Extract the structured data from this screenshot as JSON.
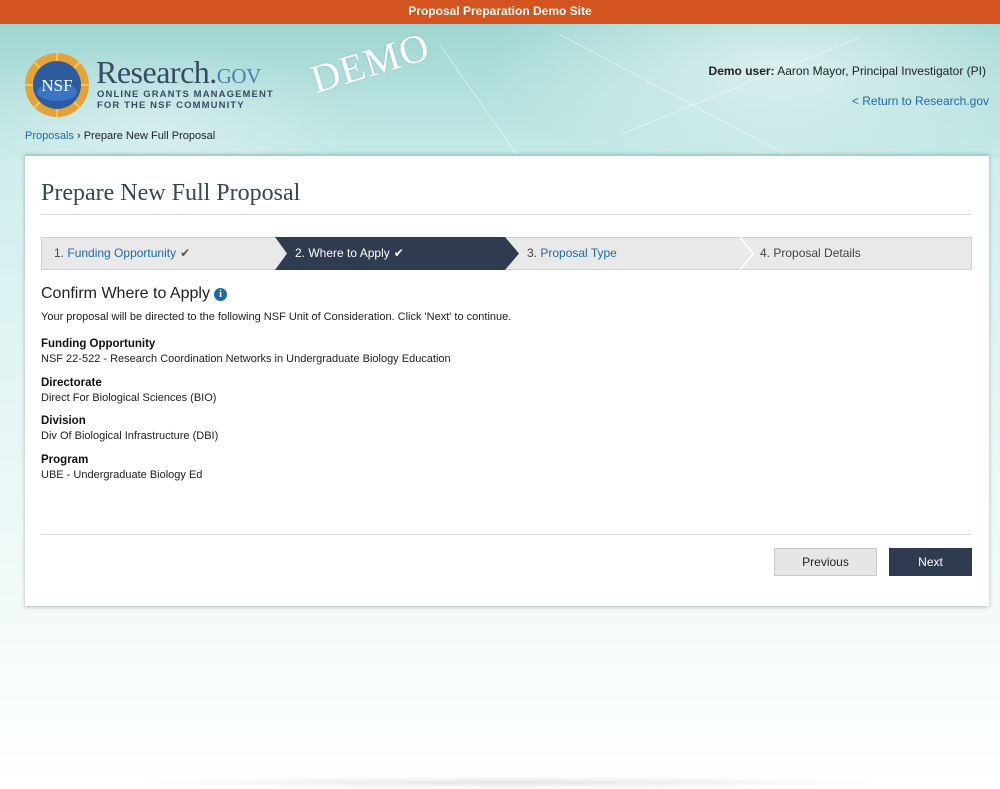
{
  "banner": {
    "text": "Proposal Preparation Demo Site"
  },
  "header": {
    "logo_main": "Research.",
    "logo_gov": "gov",
    "logo_tag_line1": "ONLINE GRANTS MANAGEMENT",
    "logo_tag_line2": "FOR THE NSF COMMUNITY",
    "seal_text": "NSF",
    "demo_stamp": "DEMO",
    "user_label": "Demo user:",
    "user_name": "Aaron Mayor, Principal Investigator (PI)",
    "return_link": "< Return to Research.gov"
  },
  "breadcrumb": {
    "link": "Proposals",
    "separator": "›",
    "current": "Prepare New Full Proposal"
  },
  "page": {
    "title": "Prepare New Full Proposal"
  },
  "steps": [
    {
      "num": "1.",
      "label": "Funding Opportunity",
      "check": "✔",
      "state": "done"
    },
    {
      "num": "2.",
      "label": "Where to Apply",
      "check": "✔",
      "state": "active"
    },
    {
      "num": "3.",
      "label": "Proposal Type",
      "check": "",
      "state": "link"
    },
    {
      "num": "4.",
      "label": "Proposal Details",
      "check": "",
      "state": "pending"
    }
  ],
  "section": {
    "title": "Confirm Where to Apply",
    "info_glyph": "i",
    "intro": "Your proposal will be directed to the following NSF Unit of Consideration. Click 'Next' to continue."
  },
  "fields": [
    {
      "label": "Funding Opportunity",
      "value": "NSF 22-522 - Research Coordination Networks in Undergraduate Biology Education"
    },
    {
      "label": "Directorate",
      "value": "Direct For Biological Sciences (BIO)"
    },
    {
      "label": "Division",
      "value": "Div Of Biological Infrastructure (DBI)"
    },
    {
      "label": "Program",
      "value": "UBE - Undergraduate Biology Ed"
    }
  ],
  "buttons": {
    "previous": "Previous",
    "next": "Next"
  },
  "colors": {
    "banner": "#d3541f",
    "active_step": "#2f3b51",
    "link": "#1e6aa8",
    "next_button": "#2f3b51"
  }
}
